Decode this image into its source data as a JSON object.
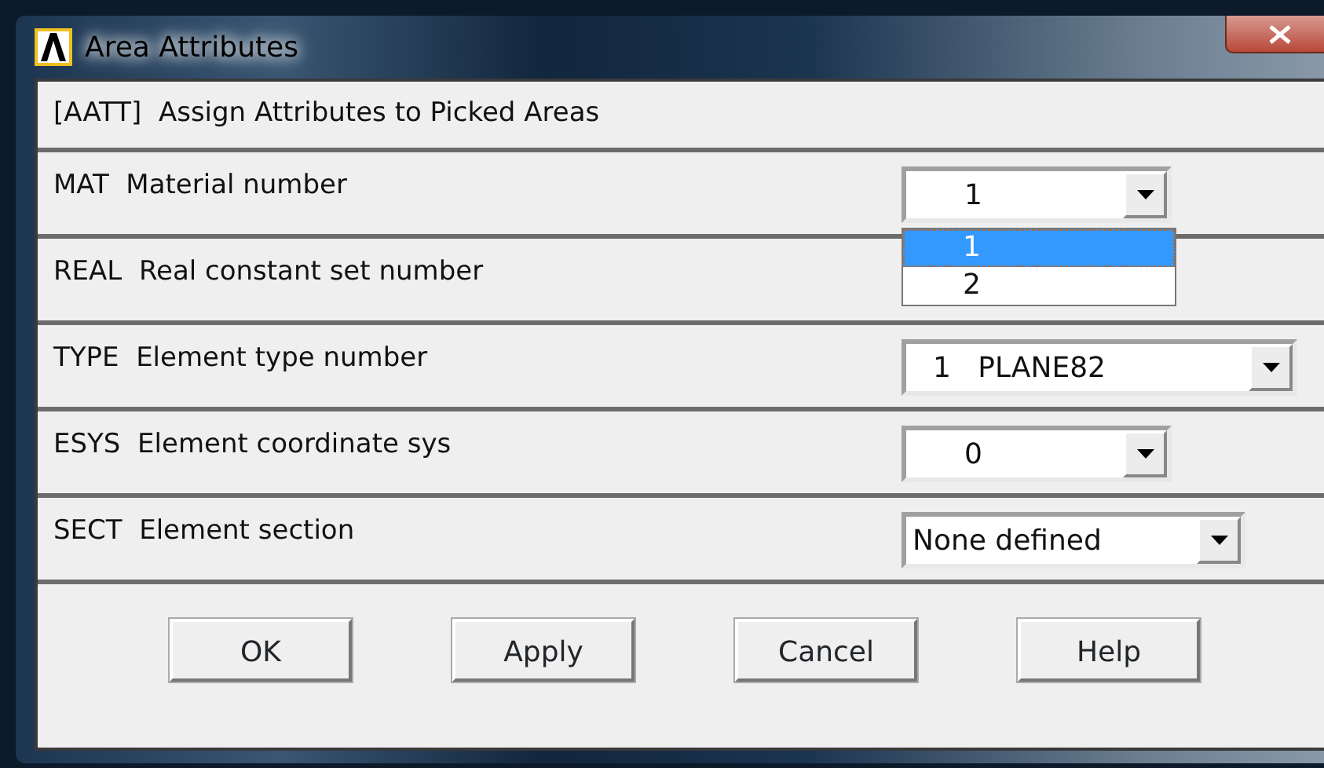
{
  "window": {
    "title": "Area Attributes"
  },
  "header": "[AATT]  Assign Attributes to Picked Areas",
  "rows": [
    {
      "label": "MAT  Material number",
      "field": {
        "value": "1",
        "kind": "short",
        "options": [
          {
            "label": "1",
            "selected": true
          },
          {
            "label": "2",
            "selected": false
          }
        ]
      }
    },
    {
      "label": "REAL  Real constant set number"
    },
    {
      "label": "TYPE  Element type number",
      "field": {
        "value": "1   PLANE82",
        "kind": "long"
      }
    },
    {
      "label": "ESYS  Element coordinate sys",
      "field": {
        "value": "0",
        "kind": "short"
      }
    },
    {
      "label": "SECT  Element section",
      "field": {
        "value": "None defined",
        "kind": "medium"
      }
    }
  ],
  "buttons": [
    "OK",
    "Apply",
    "Cancel",
    "Help"
  ]
}
